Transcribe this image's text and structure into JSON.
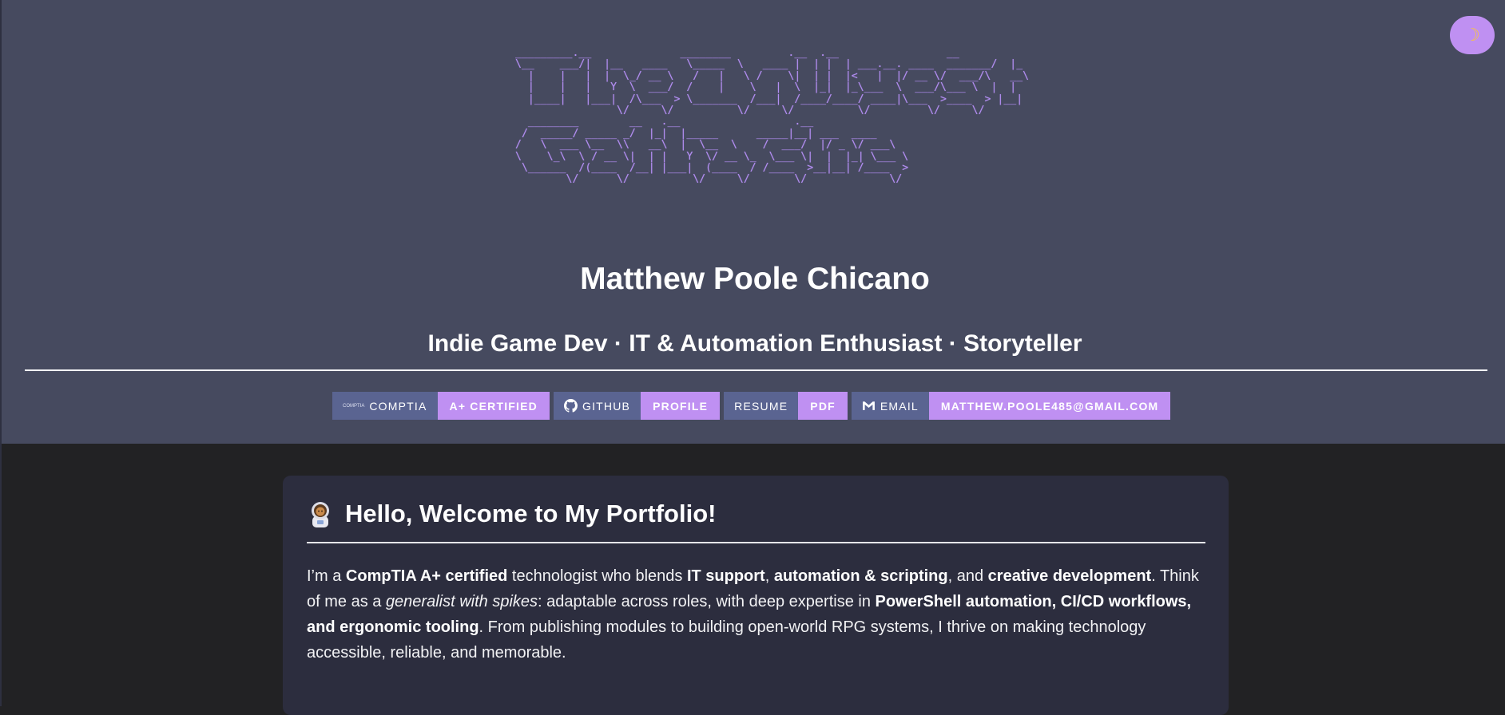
{
  "theme_toggle": {
    "icon": "crescent-moon-icon",
    "glyph": "☽"
  },
  "ascii_banner": {
    "lines": [
      "_________.__              ________         .__  .__                 __   ",
      "\\__    ___/|  |__   ____   \\_____  \\   ____ |  | |  | ___.__. ____  _______/  |_ ",
      "  |    |   |  |  \\_/ __ \\   /   |   \\ /    \\|  | |  |<   |  |/ __ \\/  ___/\\   __\\",
      "  |    |   |   Y  \\  ___/  /    |    \\   |  \\  |_|  |_\\___  \\  ___/\\___ \\  |  |  ",
      "  |____|   |___|  /\\___  > \\_______  /___|  /____/____/ ____|\\___  >____  > |__|  ",
      "                \\/     \\/          \\/     \\/          \\/         \\/     \\/        ",
      "  ________        __   .__                  .__            ",
      " /  _____/ _____ _/  |_|  |_____      _____|__| ___  ____  ",
      "/   \\  ___ \\__  \\\\   __\\  |  \\__  \\    /  ___/  |/ _ \\/ ___\\ ",
      "\\    \\_\\  \\ / __ \\|  | |   Y  \\/ __ \\_  \\___ \\|  |  |_| \\___ \\",
      " \\______  /(____  /__| |___|  (____  / /____  >__|__| /____  >",
      "        \\/      \\/          \\/     \\/       \\/             \\/ "
    ]
  },
  "header": {
    "name": "Matthew Poole Chicano",
    "tagline": "Indie Game Dev · IT & Automation Enthusiast · Storyteller"
  },
  "badges": [
    {
      "icon": "comptia-logo-icon",
      "icon_text": "CompTIA",
      "label": "CompTIA",
      "value": "A+ Certified"
    },
    {
      "icon": "github-icon",
      "label": "GitHub",
      "value": "Profile"
    },
    {
      "icon": "",
      "label": "Resume",
      "value": "PDF"
    },
    {
      "icon": "gmail-icon",
      "label": "Email",
      "value": "matthew.poole485@gmail.com"
    }
  ],
  "welcome": {
    "icon": "astronaut-icon",
    "title": "Hello, Welcome to My Portfolio!",
    "body": {
      "t1": "I’m a ",
      "b1": "CompTIA A+ certified",
      "t2": " technologist who blends ",
      "b2": "IT support",
      "t3": ", ",
      "b3": "automation & scripting",
      "t4": ", and ",
      "b4": "creative development",
      "t5": ". Think of me as a ",
      "i1": "generalist with spikes",
      "t6": ": adaptable across roles, with deep expertise in ",
      "b5": "PowerShell automation, CI/CD workflows, and ergonomic tooling",
      "t7": ". From publishing modules to building open-world RPG systems, I thrive on making technology accessible, reliable, and memorable."
    }
  },
  "colors": {
    "header_bg": "#464a5f",
    "page_bg": "#222224",
    "card_bg": "#2c2d3e",
    "accent_purple": "#bf90f2",
    "badge_left_bg": "#5a6491",
    "ascii_color": "#b38ef2"
  }
}
